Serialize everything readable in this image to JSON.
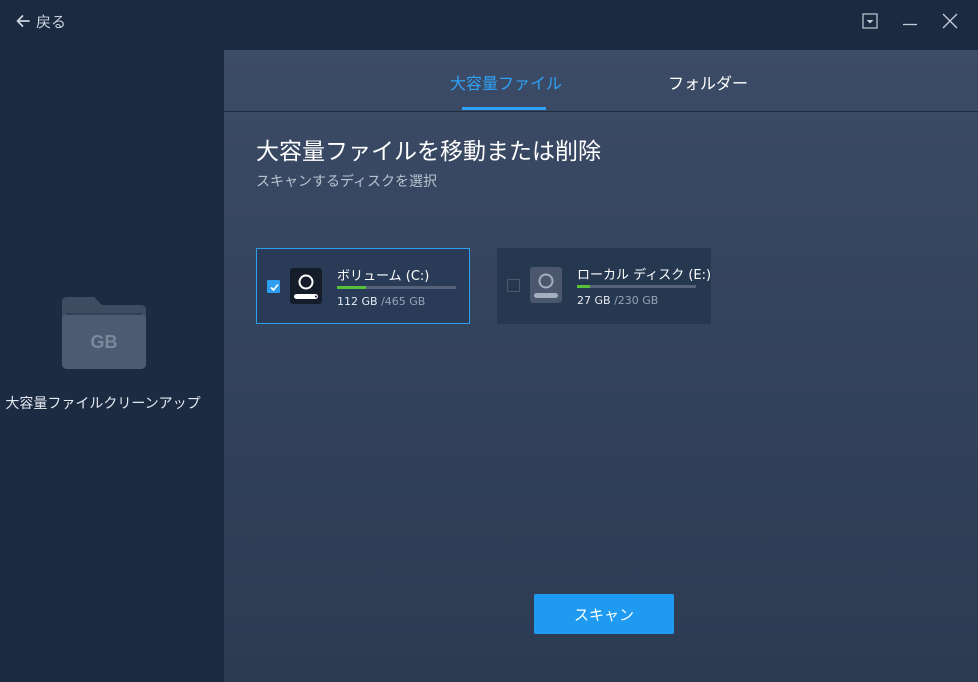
{
  "header": {
    "back_label": "戻る"
  },
  "sidebar": {
    "folder_badge": "GB",
    "feature_label": "大容量ファイルクリーンアップ"
  },
  "tabs": [
    {
      "label": "大容量ファイル",
      "active": true
    },
    {
      "label": "フォルダー",
      "active": false
    }
  ],
  "main": {
    "heading": "大容量ファイルを移動または削除",
    "subheading": "スキャンするディスクを選択"
  },
  "drives": [
    {
      "name": "ボリューム (C:)",
      "used": "112 GB",
      "total": "/465 GB",
      "usage_fraction": 0.24,
      "checked": true
    },
    {
      "name": "ローカル ディスク (E:)",
      "used": "27 GB",
      "total": "/230 GB",
      "usage_fraction": 0.11,
      "checked": false
    }
  ],
  "scan_button_label": "スキャン",
  "colors": {
    "accent": "#2fa2f5",
    "usage_bar": "#58c13b",
    "sidebar_bg": "#1c2a42",
    "main_bg": "#3c4b66"
  }
}
